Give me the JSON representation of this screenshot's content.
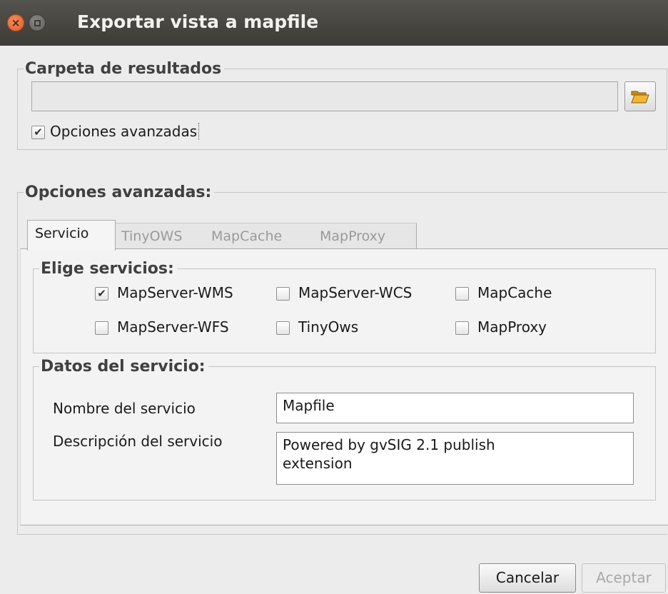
{
  "window": {
    "title": "Exportar vista a mapfile"
  },
  "carpeta": {
    "legend": "Carpeta de resultados",
    "path_value": "",
    "advanced_label": "Opciones avanzadas",
    "advanced_checked": true
  },
  "avanzadas": {
    "legend": "Opciones avanzadas:",
    "tabs": [
      "Servicio",
      "TinyOWS",
      "MapCache",
      "MapProxy"
    ],
    "active_tab": "Servicio",
    "servicios": {
      "legend": "Elige servicios:",
      "options": [
        {
          "label": "MapServer-WMS",
          "checked": true
        },
        {
          "label": "MapServer-WCS",
          "checked": false
        },
        {
          "label": "MapCache",
          "checked": false
        },
        {
          "label": "MapServer-WFS",
          "checked": false
        },
        {
          "label": "TinyOws",
          "checked": false
        },
        {
          "label": "MapProxy",
          "checked": false
        }
      ]
    },
    "datos": {
      "legend": "Datos del servicio:",
      "name_label": "Nombre del servicio",
      "name_value": "Mapfile",
      "desc_label": "Descripción del servicio",
      "desc_value": "Powered by gvSIG 2.1 publish extension"
    }
  },
  "buttons": {
    "cancel": "Cancelar",
    "accept": "Aceptar"
  },
  "icons": {
    "close": "close-icon",
    "minimize": "minimize-icon",
    "folder": "folder-icon",
    "check": "checkmark-icon"
  },
  "colors": {
    "titlebar": "#3c3b37",
    "close_button": "#e25d27",
    "folder": "#f2b632"
  }
}
